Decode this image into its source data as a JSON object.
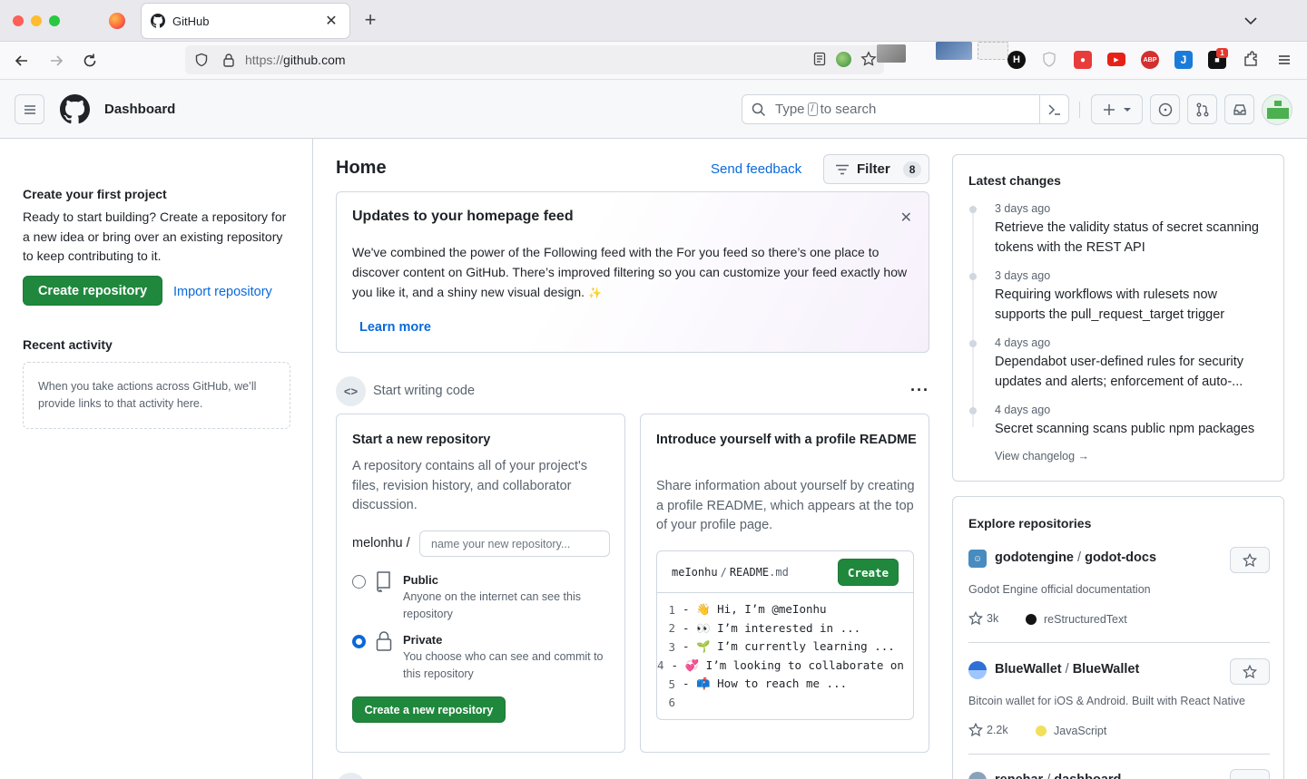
{
  "browser": {
    "tab_title": "GitHub",
    "url_protocol": "https://",
    "url_host": "github.com"
  },
  "header": {
    "title": "Dashboard",
    "search_placeholder_pre": "Type",
    "search_slash": "/",
    "search_placeholder_post": "to search"
  },
  "left": {
    "create_heading": "Create your first project",
    "create_text": "Ready to start building? Create a repository for a new idea or bring over an existing repository to keep contributing to it.",
    "create_button": "Create repository",
    "import_link": "Import repository",
    "recent_heading": "Recent activity",
    "recent_empty": "When you take actions across GitHub, we’ll provide links to that activity here."
  },
  "main": {
    "title": "Home",
    "send_feedback": "Send feedback",
    "filter_label": "Filter",
    "filter_count": "8",
    "updates": {
      "title": "Updates to your homepage feed",
      "body": "We've combined the power of the Following feed with the For you feed so there’s one place to discover content on GitHub. There’s improved filtering so you can customize your feed exactly how you like it, and a shiny new visual design.",
      "sparkle": "✨",
      "learn_more": "Learn more"
    },
    "start_writing": "Start writing code",
    "new_repo": {
      "title": "Start a new repository",
      "desc": "A repository contains all of your project's files, revision history, and collaborator discussion.",
      "owner": "melonhu /",
      "name_placeholder": "name your new repository...",
      "public_title": "Public",
      "public_desc": "Anyone on the internet can see this repository",
      "private_title": "Private",
      "private_desc": "You choose who can see and commit to this repository",
      "create_button": "Create a new repository"
    },
    "profile_readme": {
      "title": "Introduce yourself with a profile README",
      "desc": "Share information about yourself by creating a profile README, which appears at the top of your profile page.",
      "path_owner": "meIonhu",
      "path_sep": "/",
      "path_file": "README",
      "path_ext": ".md",
      "create_button": "Create",
      "lines": [
        {
          "num": "1",
          "text": "- 👋 Hi, I’m @meIonhu"
        },
        {
          "num": "2",
          "text": "- 👀 I’m interested in ..."
        },
        {
          "num": "3",
          "text": "- 🌱 I’m currently learning ..."
        },
        {
          "num": "4",
          "text": "- 💞 I’m looking to collaborate on ..."
        },
        {
          "num": "5",
          "text": "- 📫 How to reach me ..."
        },
        {
          "num": "6",
          "text": ""
        }
      ]
    }
  },
  "right": {
    "latest_heading": "Latest changes",
    "changes": [
      {
        "date": "3 days ago",
        "text": "Retrieve the validity status of secret scanning tokens with the REST API"
      },
      {
        "date": "3 days ago",
        "text": "Requiring workflows with rulesets now supports the pull_request_target trigger"
      },
      {
        "date": "4 days ago",
        "text": "Dependabot user-defined rules for security updates and alerts; enforcement of auto-..."
      },
      {
        "date": "4 days ago",
        "text": "Secret scanning scans public npm packages"
      }
    ],
    "view_changelog": "View changelog →",
    "explore_heading": "Explore repositories",
    "repos": [
      {
        "owner": "godotengine",
        "name": "godot-docs",
        "desc": "Godot Engine official documentation",
        "stars": "3k",
        "language": "reStructuredText",
        "lang_color": "#141414"
      },
      {
        "owner": "BlueWallet",
        "name": "BlueWallet",
        "desc": "Bitcoin wallet for iOS & Android. Built with React Native",
        "stars": "2.2k",
        "language": "JavaScript",
        "lang_color": "#f1e05a"
      },
      {
        "owner": "renehar",
        "name": "dashboard",
        "desc": "",
        "stars": "",
        "language": "",
        "lang_color": ""
      }
    ]
  },
  "colors": {
    "green": "#1f883d",
    "link": "#0969da",
    "border": "#d0d7de"
  }
}
